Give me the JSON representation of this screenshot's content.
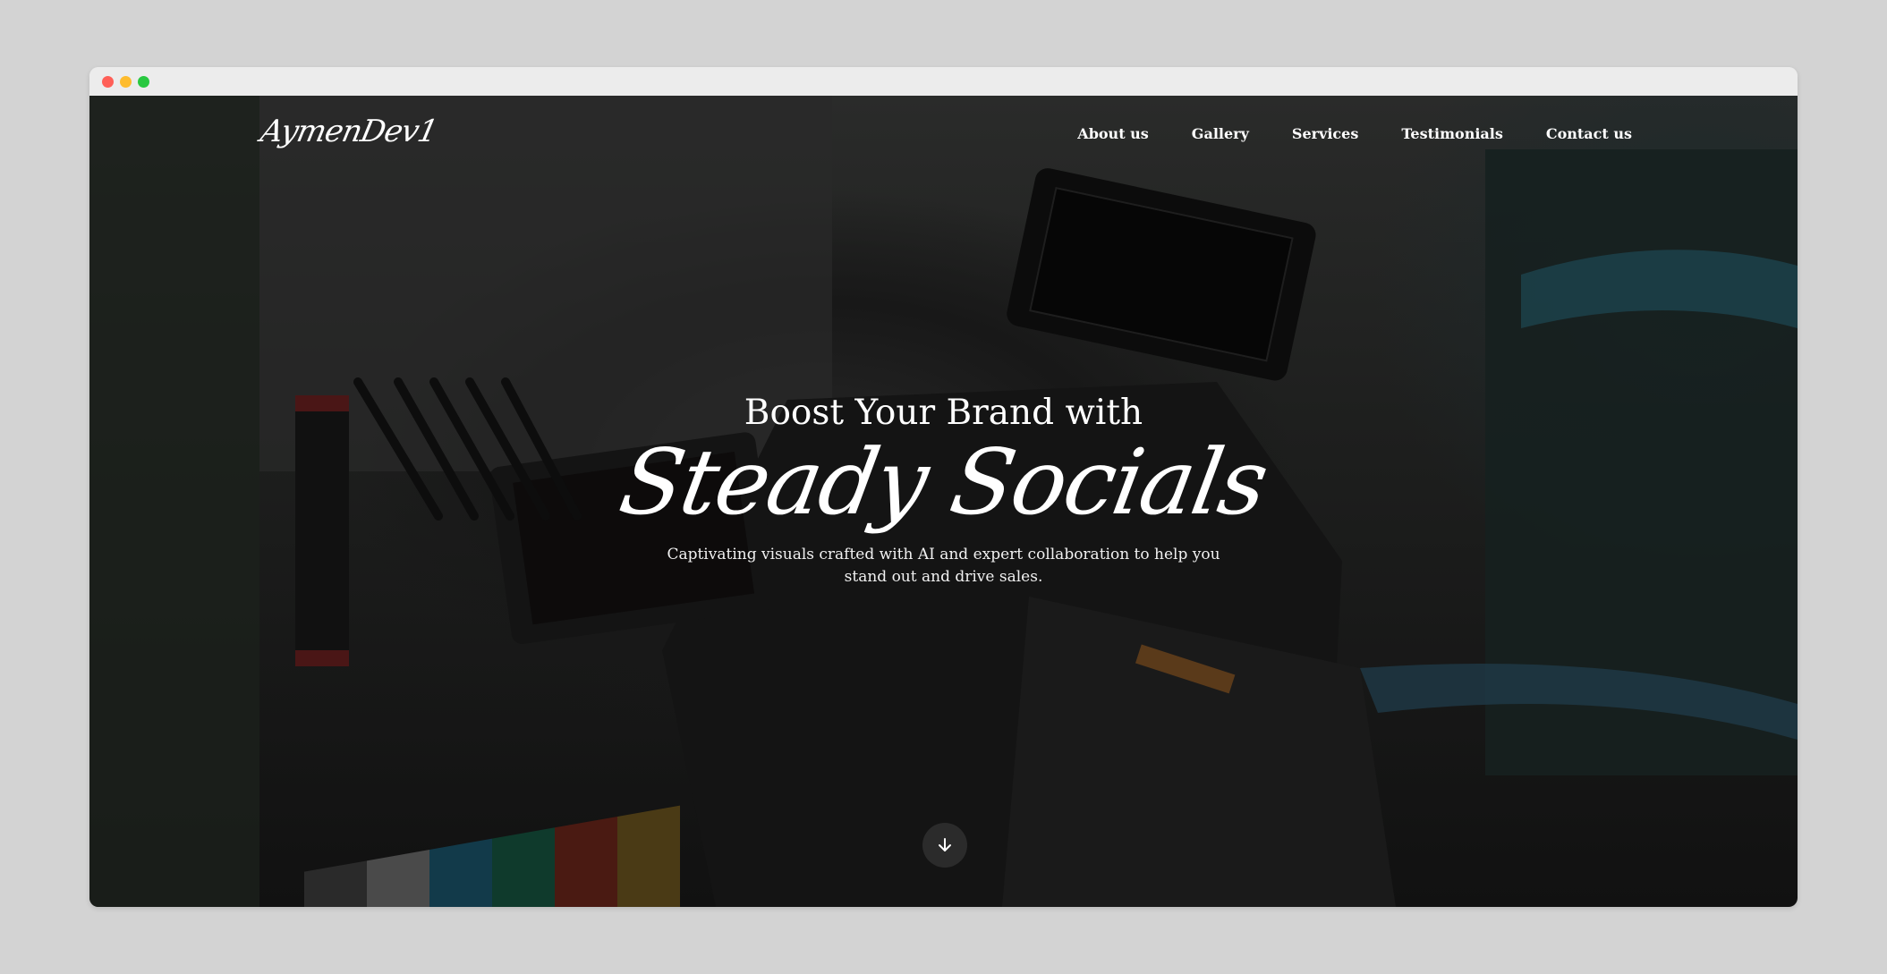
{
  "logo": {
    "text": "AymenDev1"
  },
  "nav": {
    "links": [
      {
        "label": "About us"
      },
      {
        "label": "Gallery"
      },
      {
        "label": "Services"
      },
      {
        "label": "Testimonials"
      },
      {
        "label": "Contact us"
      }
    ]
  },
  "hero": {
    "title_top": "Boost Your Brand with",
    "title_script": "Steady Socials",
    "subtitle": "Captivating visuals crafted with AI and expert collaboration to help you stand out and drive sales."
  },
  "icons": {
    "scroll": "arrow-down-icon"
  }
}
